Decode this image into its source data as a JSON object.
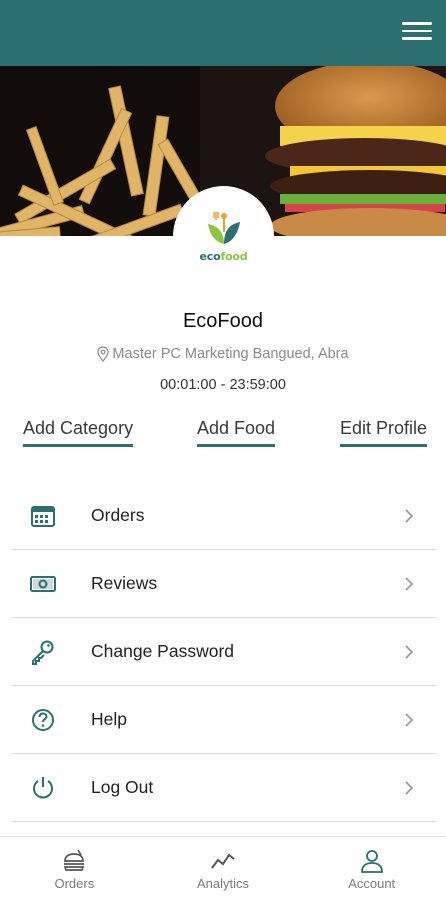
{
  "header": {
    "menu_icon": "hamburger-menu-icon",
    "color": "#2b6f70"
  },
  "logo": {
    "part1": "eco",
    "part2": "food"
  },
  "profile": {
    "name": "EcoFood",
    "address": "Master PC Marketing Bangued, Abra",
    "hours": "00:01:00 - 23:59:00"
  },
  "actions": {
    "add_category": "Add Category",
    "add_food": "Add Food",
    "edit_profile": "Edit Profile"
  },
  "menu": {
    "items": [
      {
        "label": "Orders",
        "icon": "calendar-icon"
      },
      {
        "label": "Reviews",
        "icon": "money-icon"
      },
      {
        "label": "Change Password",
        "icon": "key-icon"
      },
      {
        "label": "Help",
        "icon": "help-icon"
      },
      {
        "label": "Log Out",
        "icon": "power-icon"
      }
    ]
  },
  "bottom_nav": {
    "items": [
      {
        "label": "Orders",
        "icon": "food-icon"
      },
      {
        "label": "Analytics",
        "icon": "analytics-icon"
      },
      {
        "label": "Account",
        "icon": "person-icon",
        "active": true
      }
    ]
  },
  "colors": {
    "accent": "#2b6f70",
    "leaf_green": "#8cc63f",
    "divider": "#d9d9d9"
  }
}
